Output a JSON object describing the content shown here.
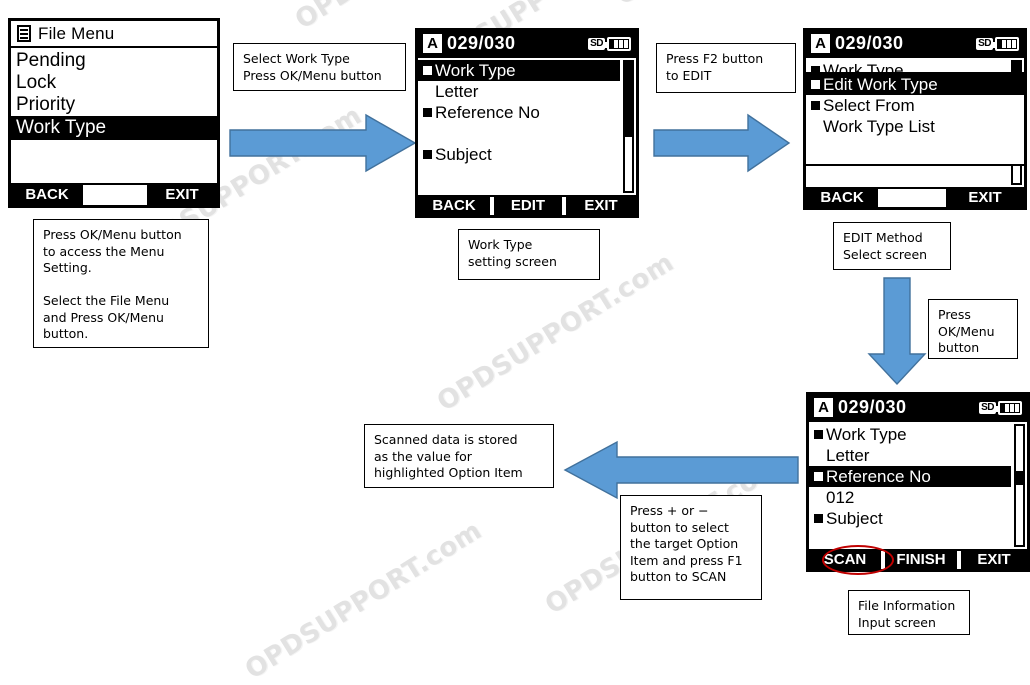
{
  "watermark": {
    "text": "OPDSUPPORT.com",
    "color": "#e2e2e2"
  },
  "theme": {
    "arrow_fill": "#5B9BD5",
    "arrow_stroke": "#41719C",
    "highlight_circle": "#C00000",
    "screen_bg": "#FFFFFF",
    "screen_fg": "#000000"
  },
  "screens": {
    "file_menu": {
      "header_title": "File Menu",
      "header_icon": "file-list-icon",
      "items": [
        {
          "label": "Pending",
          "selected": false
        },
        {
          "label": "Lock",
          "selected": false
        },
        {
          "label": "Priority",
          "selected": false
        },
        {
          "label": "Work Type",
          "selected": true
        }
      ],
      "softkeys": {
        "f1": "BACK",
        "f2": "",
        "f3": "EXIT"
      }
    },
    "work_type_setting": {
      "mode_badge": "A",
      "counter": "029/030",
      "sd_badge": "SD",
      "battery_icon": "battery-full-icon",
      "items": [
        {
          "label": "Work Type",
          "bullet": true,
          "selected": true
        },
        {
          "label": "Letter",
          "bullet": false,
          "selected": false
        },
        {
          "label": "Reference No",
          "bullet": true,
          "selected": false
        },
        {
          "label": "",
          "bullet": false,
          "selected": false
        },
        {
          "label": "Subject",
          "bullet": true,
          "selected": false
        }
      ],
      "softkeys": {
        "f1": "BACK",
        "f2": "EDIT",
        "f3": "EXIT"
      }
    },
    "edit_method_select": {
      "mode_badge": "A",
      "counter": "029/030",
      "sd_badge": "SD",
      "battery_icon": "battery-full-icon",
      "background_item": "Work Type",
      "dialog_items": [
        {
          "label": "Edit Work Type",
          "bullet": true,
          "selected": true
        },
        {
          "label": "Select From",
          "bullet": true,
          "selected": false
        },
        {
          "label": "Work Type List",
          "bullet": false,
          "selected": false
        }
      ],
      "softkeys": {
        "f1": "BACK",
        "f2": "",
        "f3": "EXIT"
      }
    },
    "file_information_input": {
      "mode_badge": "A",
      "counter": "029/030",
      "sd_badge": "SD",
      "battery_icon": "battery-full-icon",
      "items": [
        {
          "label": "Work Type",
          "bullet": true,
          "selected": false
        },
        {
          "label": "Letter",
          "bullet": false,
          "selected": false
        },
        {
          "label": "Reference No",
          "bullet": true,
          "selected": true
        },
        {
          "label": "012",
          "bullet": false,
          "selected": false
        },
        {
          "label": "Subject",
          "bullet": true,
          "selected": false
        }
      ],
      "softkeys": {
        "f1": "SCAN",
        "f2": "FINISH",
        "f3": "EXIT"
      },
      "highlighted_softkey": "SCAN"
    }
  },
  "notes": {
    "note_menu_access": "Press OK/Menu button\nto access the Menu\nSetting.\n\nSelect the File Menu\nand Press OK/Menu\nbutton.",
    "note_select_work_type": "Select Work Type\nPress OK/Menu button",
    "note_work_type_setting": "Work Type\nsetting screen",
    "note_press_f2": "Press F2 button\nto EDIT",
    "note_edit_method": "EDIT Method\nSelect screen",
    "note_press_ok_menu": "Press\nOK/Menu\nbutton",
    "note_file_info": "File Information\nInput screen",
    "note_press_plus_minus": "Press + or −\nbutton to select\nthe target Option\nItem and press F1\nbutton to SCAN",
    "note_scanned_data": "Scanned data is stored\nas the value for\nhighlighted Option Item"
  }
}
